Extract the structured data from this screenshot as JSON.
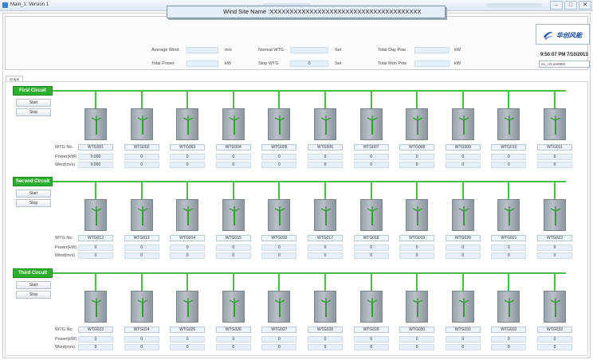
{
  "window": {
    "title": "Main_1: Version 1"
  },
  "header": {
    "site_name": "Wind Site Name :XXXXXXXXXXXXXXXXXXXXXXXXXXXXXXXXXXXXXX",
    "avg_wind": {
      "label": "Average Wind",
      "value": "",
      "unit": "m/s"
    },
    "total_power": {
      "label": "Total Power",
      "value": "",
      "unit": "kW"
    },
    "normal_wtg": {
      "label": "Normal WTG",
      "value": "",
      "unit": "Set"
    },
    "stop_wtg": {
      "label": "Stop WTG",
      "value": "0",
      "unit": "Set"
    },
    "total_day_pow": {
      "label": "Total Day Pow",
      "value": "",
      "unit": "kW"
    },
    "total_mon_pow": {
      "label": "Total Mon Pow",
      "value": "",
      "unit": "kW"
    },
    "logo_text": "华创风能",
    "clock": "9:50:07 PM  7/10/2013",
    "language": "en_US.en8859"
  },
  "tab": {
    "label": "Graph"
  },
  "row_labels": {
    "wtg_no": "WTG No.",
    "power": "Power(kW)",
    "wind": "Wind(m/s)"
  },
  "buttons": {
    "start": "Start",
    "stop": "Stop"
  },
  "circuits": [
    {
      "label": "First Circuit",
      "turbines": [
        {
          "id": "WTG001",
          "power": "0.000",
          "wind": "0.000"
        },
        {
          "id": "WTG002",
          "power": "0",
          "wind": "0"
        },
        {
          "id": "WTG003",
          "power": "0",
          "wind": "0"
        },
        {
          "id": "WTG004",
          "power": "0",
          "wind": "0"
        },
        {
          "id": "WTG005",
          "power": "0",
          "wind": "0"
        },
        {
          "id": "WTG006",
          "power": "0",
          "wind": "0"
        },
        {
          "id": "WTG007",
          "power": "0",
          "wind": "0"
        },
        {
          "id": "WTG008",
          "power": "0",
          "wind": "0"
        },
        {
          "id": "WTG009",
          "power": "0",
          "wind": "0"
        },
        {
          "id": "WTG010",
          "power": "0",
          "wind": "0"
        },
        {
          "id": "WTG011",
          "power": "0",
          "wind": "0"
        }
      ]
    },
    {
      "label": "Second Circuit",
      "turbines": [
        {
          "id": "WTG012",
          "power": "0",
          "wind": "0"
        },
        {
          "id": "WTG013",
          "power": "0",
          "wind": "0"
        },
        {
          "id": "WTG014",
          "power": "0",
          "wind": "0"
        },
        {
          "id": "WTG015",
          "power": "0",
          "wind": "0"
        },
        {
          "id": "WTG016",
          "power": "0",
          "wind": "0"
        },
        {
          "id": "WTG017",
          "power": "0",
          "wind": "0"
        },
        {
          "id": "WTG018",
          "power": "0",
          "wind": "0"
        },
        {
          "id": "WTG019",
          "power": "0",
          "wind": "0"
        },
        {
          "id": "WTG020",
          "power": "0",
          "wind": "0"
        },
        {
          "id": "WTG021",
          "power": "0",
          "wind": "0"
        },
        {
          "id": "WTG022",
          "power": "0",
          "wind": "0"
        }
      ]
    },
    {
      "label": "Third Circuit",
      "turbines": [
        {
          "id": "WTG023",
          "power": "0",
          "wind": "0"
        },
        {
          "id": "WTG024",
          "power": "0",
          "wind": "0"
        },
        {
          "id": "WTG025",
          "power": "0",
          "wind": "0"
        },
        {
          "id": "WTG026",
          "power": "0",
          "wind": "0"
        },
        {
          "id": "WTG027",
          "power": "0",
          "wind": "0"
        },
        {
          "id": "WTG028",
          "power": "0",
          "wind": "0"
        },
        {
          "id": "WTG029",
          "power": "0",
          "wind": "0"
        },
        {
          "id": "WTG030",
          "power": "0",
          "wind": "0"
        },
        {
          "id": "WTG031",
          "power": "0",
          "wind": "0"
        },
        {
          "id": "WTG032",
          "power": "0",
          "wind": "0"
        },
        {
          "id": "WTG033",
          "power": "0",
          "wind": "0"
        }
      ]
    }
  ],
  "colors": {
    "circuit_green": "#2eae2e",
    "bus_green": "#48c048",
    "field_blue": "#e6f0f8"
  }
}
